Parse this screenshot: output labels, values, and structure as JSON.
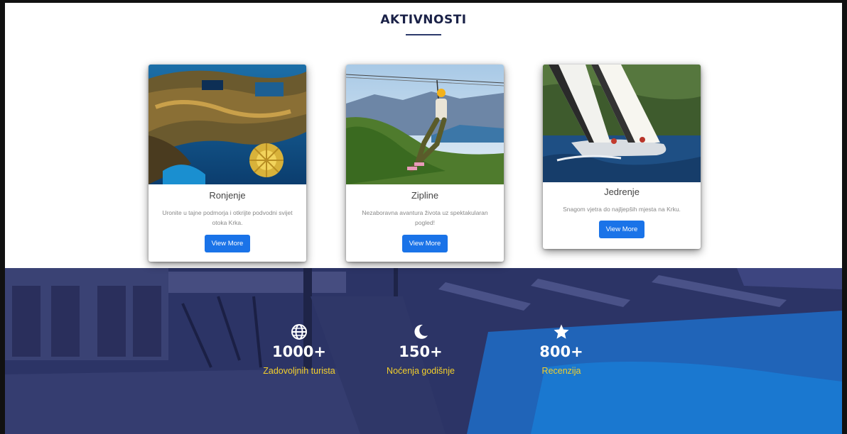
{
  "section": {
    "title": "AKTIVNOSTI"
  },
  "cards": [
    {
      "title": "Ronjenje",
      "text": "Uronite u tajne podmorja i otkrijte podvodni svijet otoka Krka.",
      "button": "View More",
      "image_icon": "underwater-wreck-photo"
    },
    {
      "title": "Zipline",
      "text": "Nezaboravna avantura života uz spektakularan pogled!",
      "button": "View More",
      "image_icon": "zipline-photo"
    },
    {
      "title": "Jedrenje",
      "text": "Snagom vjetra do najljepših mjesta na Krku.",
      "button": "View More",
      "image_icon": "sailing-photo"
    }
  ],
  "stats": [
    {
      "icon": "globe-icon",
      "number": "1000+",
      "label": "Zadovoljnih turista"
    },
    {
      "icon": "moon-icon",
      "number": "150+",
      "label": "Noćenja godišnje"
    },
    {
      "icon": "star-icon",
      "number": "800+",
      "label": "Recenzija"
    }
  ],
  "colors": {
    "heading": "#1a2147",
    "button": "#1a73e8",
    "stats_overlay": "#2d3568",
    "stats_label": "#f4d02b"
  }
}
